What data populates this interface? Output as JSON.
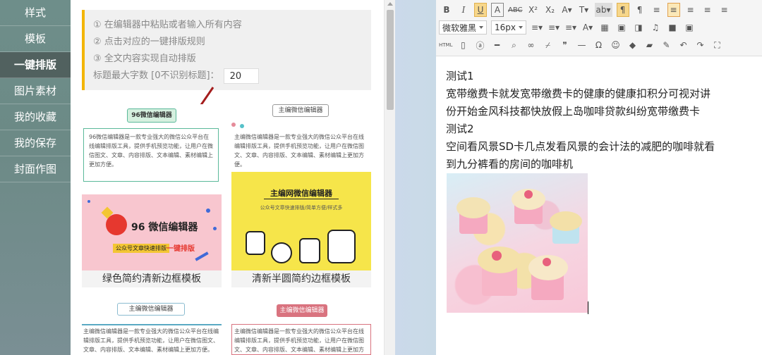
{
  "sidebar": {
    "items": [
      {
        "label": "样式",
        "active": false
      },
      {
        "label": "模板",
        "active": false
      },
      {
        "label": "一键排版",
        "active": true
      },
      {
        "label": "图片素材",
        "active": false
      },
      {
        "label": "我的收藏",
        "active": false
      },
      {
        "label": "我的保存",
        "active": false
      },
      {
        "label": "封面作图",
        "active": false
      }
    ]
  },
  "instructions": {
    "step1": "① 在编辑器中粘贴或者输入所有内容",
    "step2": "② 点击对应的一键排版规则",
    "step3": "③ 全文内容实现自动排版",
    "max_label": "标题最大字数 [0不识别标题]：",
    "max_value": "20"
  },
  "templates": [
    {
      "caption": "绿色简约清新边框模板",
      "tag": "96微信编辑器",
      "banner": "96 微信编辑器",
      "banner_tag": "公众号文章快速排版",
      "banner_tag2": "一键排版"
    },
    {
      "caption": "清新半圆简约边框模板",
      "tag": "主编微信编辑器",
      "banner": "主编网微信编辑器",
      "banner_sub": "公众号文章快速排版/简单方便/样式多"
    },
    {
      "tag": "主编微信编辑器"
    },
    {
      "tag": "主编微信编辑器"
    }
  ],
  "template_text": "主编微信编辑器是一款专业强大的微信公众平台在线编辑排版工具，提供手机预览功能，让用户在微信图文、文章、内容排版、文本编辑、素材编辑上更加方便。",
  "template_text_96": "96微信编辑器是一款专业强大的微信公众平台在线编辑排版工具，提供手机预览功能，让用户在微信图文、文章、内容排版、文本编辑、素材编辑上更加方便。",
  "toolbar": {
    "row1": [
      "B",
      "I",
      "U",
      "A",
      "ABC",
      "X²",
      "X₂",
      "A▾",
      "T▾",
      "ab▾",
      "¶",
      "¶",
      "≡",
      "≡",
      "≡",
      "≡",
      "≡"
    ],
    "font_family": "微软雅黑",
    "font_size": "16px",
    "row3_html": "HTML"
  },
  "editor": {
    "lines": [
      "测试1",
      "宽带缴费卡就发宽带缴费卡的健康的健康扣积分可视对讲",
      "份开始金风科技都快放假上岛咖啡贷款纠纷宽带缴费卡",
      "测试2",
      "空间看风景SD卡几点发看风景的会计法的减肥的咖啡就看",
      "到九分裤看的房间的咖啡机"
    ]
  },
  "colors": {
    "accent_yellow": "#f3b500",
    "sidebar_active": "#51615f",
    "tpl_green": "#5bb99a",
    "tpl_yellow": "#f6e54a",
    "tpl_pink": "#f8c6cf"
  }
}
